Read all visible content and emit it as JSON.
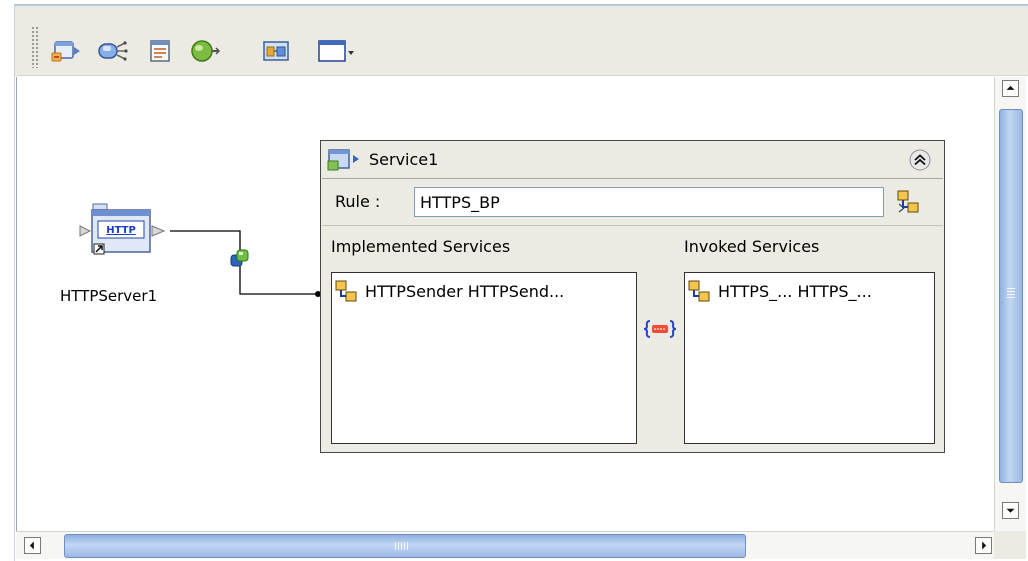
{
  "toolbar": {
    "buttons": [
      {
        "name": "add-external-application",
        "icon": "external-application-icon"
      },
      {
        "name": "add-connector",
        "icon": "connector-icon"
      },
      {
        "name": "add-document",
        "icon": "document-icon"
      },
      {
        "name": "add-service",
        "icon": "cylinder-icon"
      },
      {
        "name": "add-business-process",
        "icon": "business-process-icon"
      },
      {
        "name": "window-menu",
        "icon": "window-dropdown-icon"
      }
    ]
  },
  "canvas": {
    "http_server": {
      "label": "HTTPServer1",
      "badge": "HTTP",
      "icon": "http-server-icon"
    },
    "service": {
      "title": "Service1",
      "rule_label": "Rule :",
      "rule_value": "HTTPS_BP",
      "implemented_title": "Implemented Services",
      "invoked_title": "Invoked Services",
      "implemented_items": [
        "HTTPSender HTTPSend..."
      ],
      "invoked_items": [
        "HTTPS_... HTTPS_..."
      ]
    }
  },
  "colors": {
    "toolbar_bg": "#ecebe3",
    "scroll_thumb": "#a9c3ea",
    "panel_bg": "#ecebe3",
    "frame_border": "#b4c6e2"
  }
}
